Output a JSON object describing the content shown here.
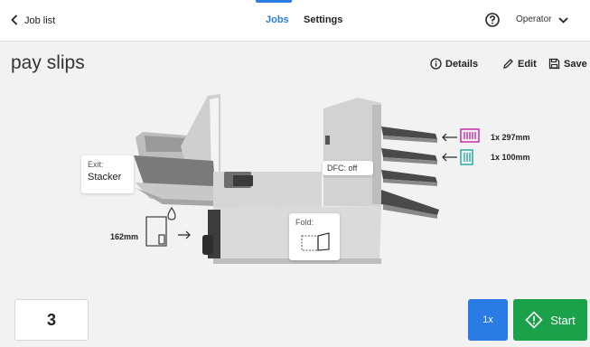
{
  "topbar": {
    "back_label": "Job list",
    "tabs": [
      {
        "label": "Jobs",
        "active": true
      },
      {
        "label": "Settings",
        "active": false
      }
    ],
    "help_icon": "help-circle-icon",
    "operator_label": "Operator"
  },
  "page": {
    "title": "pay slips",
    "actions": {
      "details": "Details",
      "edit": "Edit",
      "save": "Save"
    }
  },
  "machine": {
    "exit_label": "Exit:",
    "exit_value": "Stacker",
    "dfc": "DFC: off",
    "fold_label": "Fold:",
    "feeders": [
      {
        "label": "1x 297mm",
        "color": "#c81ea3"
      },
      {
        "label": "1x 100mm",
        "color": "#1aa8a0"
      }
    ],
    "envelope_length": "162mm"
  },
  "bottom": {
    "count": "3",
    "multiplier": "1x",
    "start_label": "Start"
  },
  "colors": {
    "accent": "#2a7be4",
    "start": "#1aa14a"
  }
}
